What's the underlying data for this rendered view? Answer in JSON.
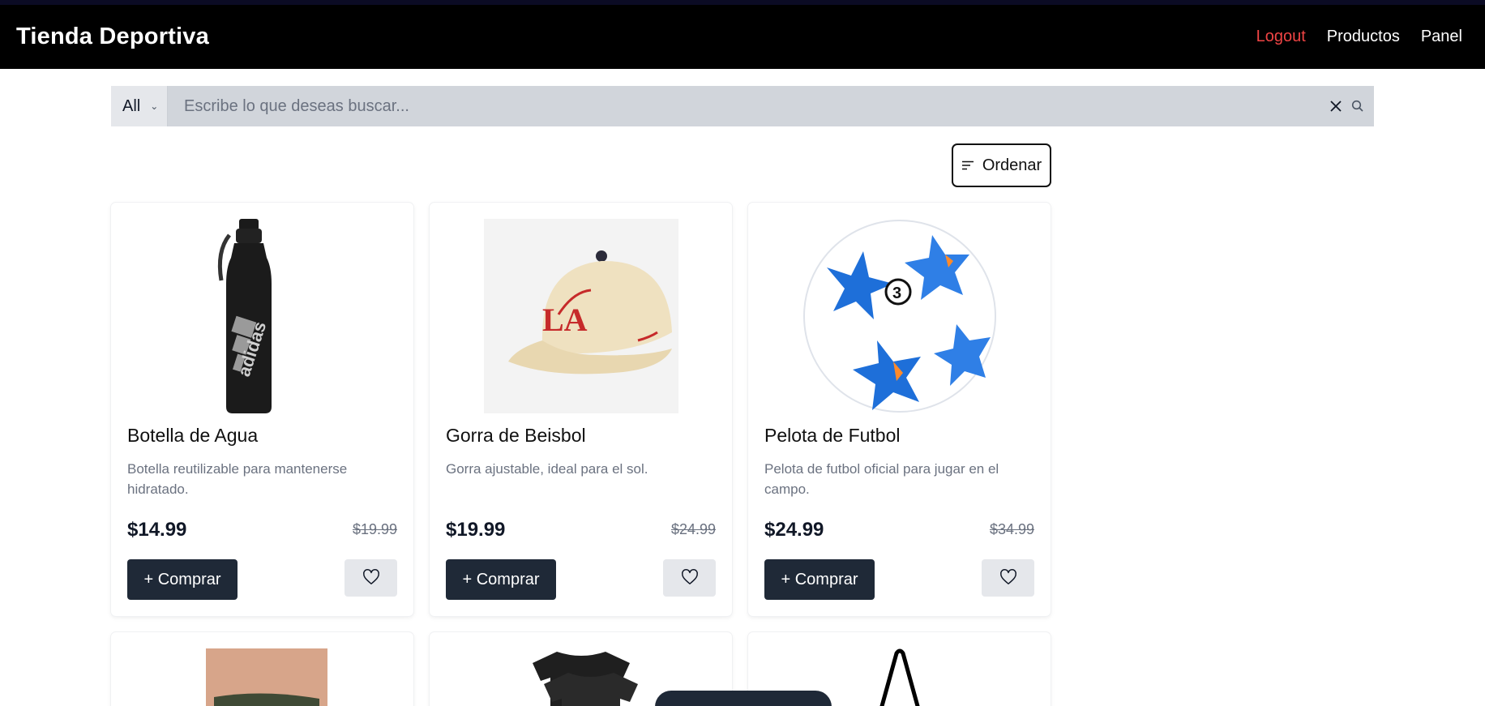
{
  "header": {
    "brand": "Tienda Deportiva",
    "nav": {
      "logout": "Logout",
      "products": "Productos",
      "panel": "Panel"
    },
    "colors": {
      "logout": "#ef4444",
      "background": "#000000"
    }
  },
  "search": {
    "category_selected": "All",
    "placeholder": "Escribe lo que deseas buscar...",
    "value": ""
  },
  "sort": {
    "label": "Ordenar"
  },
  "products": [
    {
      "name": "Botella de Agua",
      "description": "Botella reutilizable para mantenerse hidratado.",
      "price": "$14.99",
      "old_price": "$19.99",
      "buy_label": "+ Comprar",
      "brand_on_image": "adidas"
    },
    {
      "name": "Gorra de Beisbol",
      "description": "Gorra ajustable, ideal para el sol.",
      "price": "$19.99",
      "old_price": "$24.99",
      "buy_label": "+ Comprar"
    },
    {
      "name": "Pelota de Futbol",
      "description": "Pelota de futbol oficial para jugar en el campo.",
      "price": "$24.99",
      "old_price": "$34.99",
      "buy_label": "+ Comprar"
    }
  ]
}
